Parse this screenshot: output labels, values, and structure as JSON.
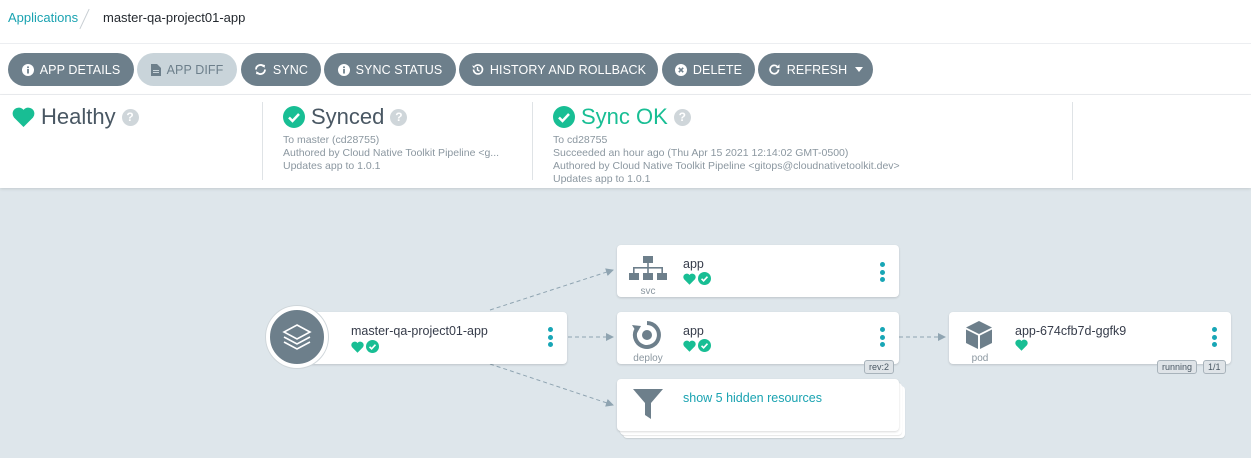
{
  "breadcrumb": {
    "root": "Applications",
    "current": "master-qa-project01-app"
  },
  "toolbar": {
    "app_details": "APP DETAILS",
    "app_diff": "APP DIFF",
    "sync": "SYNC",
    "sync_status": "SYNC STATUS",
    "history": "HISTORY AND ROLLBACK",
    "delete": "DELETE",
    "refresh": "REFRESH"
  },
  "status": {
    "health": {
      "title": "Healthy"
    },
    "sync": {
      "title": "Synced",
      "line1": "To master (cd28755)",
      "line2": "Authored by Cloud Native Toolkit Pipeline <g...",
      "line3": "Updates app to 1.0.1"
    },
    "operation": {
      "title": "Sync OK",
      "line1": "To cd28755",
      "line2": "Succeeded an hour ago (Thu Apr 15 2021 12:14:02 GMT-0500)",
      "line3": "Authored by Cloud Native Toolkit Pipeline <gitops@cloudnativetoolkit.dev>",
      "line4": "Updates app to 1.0.1"
    }
  },
  "graph": {
    "app_node": {
      "name": "master-qa-project01-app"
    },
    "svc_node": {
      "name": "app",
      "kind": "svc"
    },
    "deploy_node": {
      "name": "app",
      "kind": "deploy",
      "rev": "rev:2"
    },
    "hidden_node": {
      "label": "show 5 hidden resources"
    },
    "pod_node": {
      "name": "app-674cfb7d-ggfk9",
      "kind": "pod",
      "status": "running",
      "ready": "1/1"
    }
  },
  "colors": {
    "accent": "#1aa3b1",
    "healthy": "#18be94",
    "button": "#6d7f8b"
  }
}
